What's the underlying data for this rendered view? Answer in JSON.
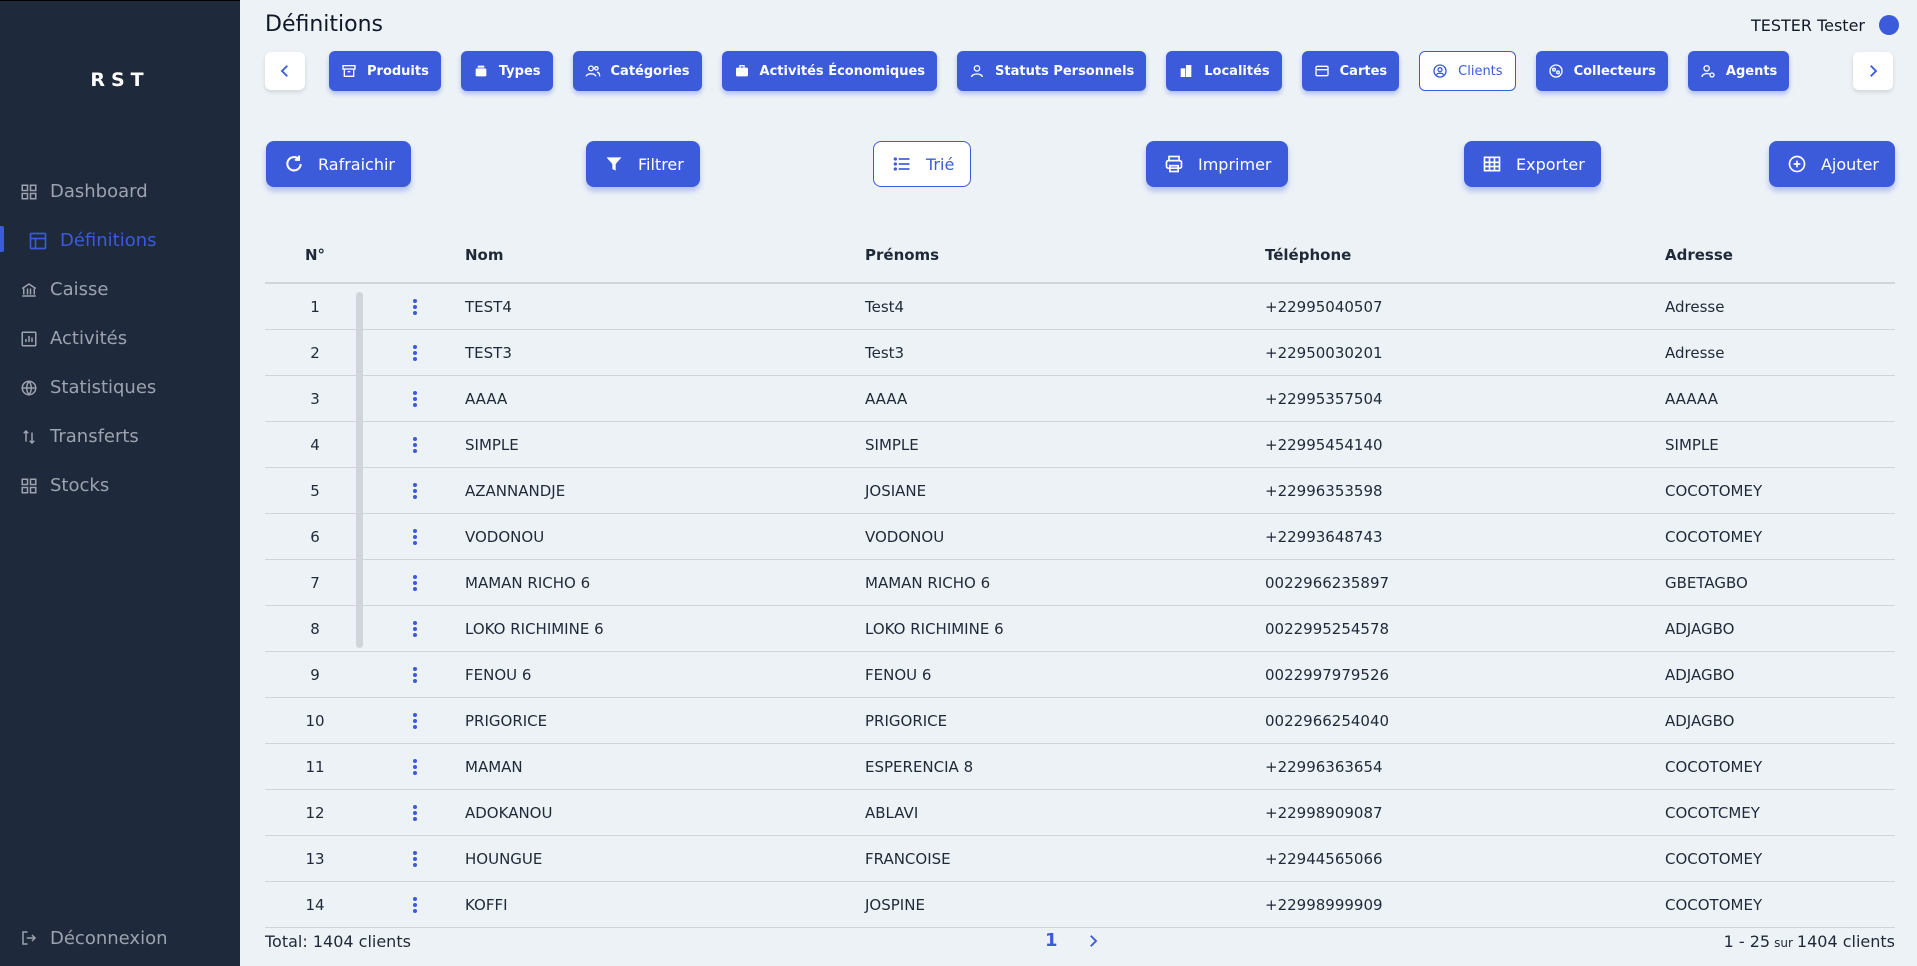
{
  "brand": "RST",
  "sidebar": {
    "items": [
      {
        "label": "Dashboard",
        "icon": "dashboard-icon"
      },
      {
        "label": "Définitions",
        "icon": "table-icon",
        "active": true
      },
      {
        "label": "Caisse",
        "icon": "bank-icon"
      },
      {
        "label": "Activités",
        "icon": "chart-icon"
      },
      {
        "label": "Statistiques",
        "icon": "globe-icon"
      },
      {
        "label": "Transferts",
        "icon": "transfer-icon"
      },
      {
        "label": "Stocks",
        "icon": "grid-icon"
      }
    ],
    "logout": "Déconnexion"
  },
  "header": {
    "title": "Définitions",
    "user": "TESTER Tester"
  },
  "tabs": [
    "Produits",
    "Types",
    "Catégories",
    "Activités Économiques",
    "Statuts Personnels",
    "Localités",
    "Cartes",
    "Clients",
    "Collecteurs",
    "Agents"
  ],
  "active_tab": "Clients",
  "toolbar": {
    "refresh": "Rafraichir",
    "filter": "Filtrer",
    "sort": "Trié",
    "print": "Imprimer",
    "export": "Exporter",
    "add": "Ajouter"
  },
  "table": {
    "columns": [
      "N°",
      "Nom",
      "Prénoms",
      "Téléphone",
      "Adresse"
    ],
    "rows": [
      [
        "1",
        "TEST4",
        "Test4",
        "+22995040507",
        "Adresse"
      ],
      [
        "2",
        "TEST3",
        "Test3",
        "+22950030201",
        "Adresse"
      ],
      [
        "3",
        "AAAA",
        "AAAA",
        "+22995357504",
        "AAAAA"
      ],
      [
        "4",
        "SIMPLE",
        "SIMPLE",
        "+22995454140",
        "SIMPLE"
      ],
      [
        "5",
        "AZANNANDJE",
        "JOSIANE",
        "+22996353598",
        "COCOTOMEY"
      ],
      [
        "6",
        "VODONOU",
        "VODONOU",
        "+22993648743",
        "COCOTOMEY"
      ],
      [
        "7",
        "MAMAN RICHO 6",
        "MAMAN RICHO 6",
        "0022966235897",
        "GBETAGBO"
      ],
      [
        "8",
        "LOKO RICHIMINE 6",
        "LOKO RICHIMINE 6",
        "0022995254578",
        "ADJAGBO"
      ],
      [
        "9",
        "FENOU 6",
        "FENOU 6",
        "0022997979526",
        "ADJAGBO"
      ],
      [
        "10",
        "PRIGORICE",
        "PRIGORICE",
        "0022966254040",
        "ADJAGBO"
      ],
      [
        "11",
        "MAMAN",
        "ESPERENCIA 8",
        "+22996363654",
        "COCOTOMEY"
      ],
      [
        "12",
        "ADOKANOU",
        "ABLAVI",
        "+22998909087",
        "COCOTCMEY"
      ],
      [
        "13",
        "HOUNGUE",
        "FRANCOISE",
        "+22944565066",
        "COCOTOMEY"
      ],
      [
        "14",
        "KOFFI",
        "JOSPINE",
        "+22998999909",
        "COCOTOMEY"
      ]
    ]
  },
  "footer": {
    "total": "Total: 1404 clients",
    "page": "1",
    "range_start": "1 - 25",
    "range_sur": "sur",
    "range_end": "1404 clients"
  },
  "colors": {
    "accent": "#3b5bdb",
    "sidebar_bg": "#1e293b",
    "page_bg": "#edf2f7"
  }
}
